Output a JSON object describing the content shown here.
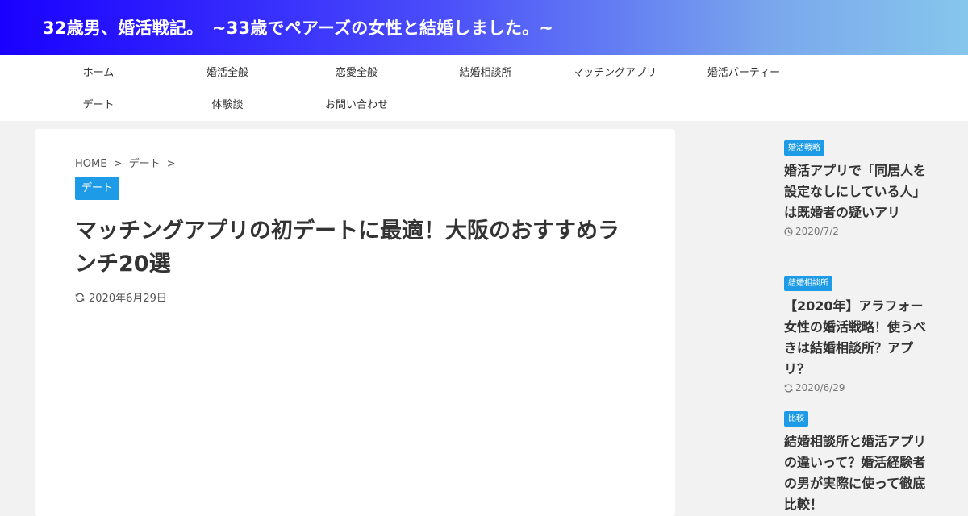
{
  "site": {
    "title": "32歳男、婚活戦記。　~33歳でペアーズの女性と結婚しました。~"
  },
  "nav": {
    "items": [
      "ホーム",
      "婚活全般",
      "恋愛全般",
      "結婚相談所",
      "マッチングアプリ",
      "婚活パーティー",
      "デート",
      "体験談",
      "お問い合わせ"
    ]
  },
  "breadcrumb": {
    "home": "HOME",
    "sep1": ">",
    "category": "デート",
    "sep2": ">"
  },
  "post": {
    "category": "デート",
    "title": "マッチングアプリの初デートに最適！大阪のおすすめランチ20選",
    "date": "2020年6月29日"
  },
  "sidebar": {
    "items": [
      {
        "category": "婚活戦略",
        "title": "婚活アプリで「同居人を設定なしにしている人」は既婚者の疑いアリ",
        "date": "2020/7/2",
        "date_icon": "clock-icon"
      },
      {
        "category": "結婚相談所",
        "title": "【2020年】アラフォー女性の婚活戦略！使うべきは結婚相談所？アプリ？",
        "date": "2020/6/29",
        "date_icon": "refresh-icon"
      },
      {
        "category": "比較",
        "title": "結婚相談所と婚活アプリの違いって？婚活経験者の男が実際に使って徹底比較！",
        "date": "",
        "date_icon": ""
      }
    ]
  },
  "colors": {
    "accent": "#1e9be6",
    "header_start": "#1a00ff",
    "header_end": "#86c6ec"
  }
}
